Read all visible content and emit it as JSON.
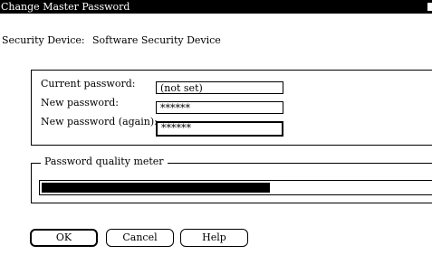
{
  "window": {
    "title": "Change Master Password"
  },
  "device": {
    "label": "Security Device:",
    "value": "Software Security Device"
  },
  "fields": {
    "current_label": "Current password:",
    "current_value": "(not set)",
    "new_label": "New password:",
    "new_value": "******",
    "again_label": "New password (again):",
    "again_value": "******"
  },
  "meter": {
    "label": "Password quality meter",
    "level": 0.58
  },
  "buttons": {
    "ok": "OK",
    "cancel": "Cancel",
    "help": "Help"
  }
}
